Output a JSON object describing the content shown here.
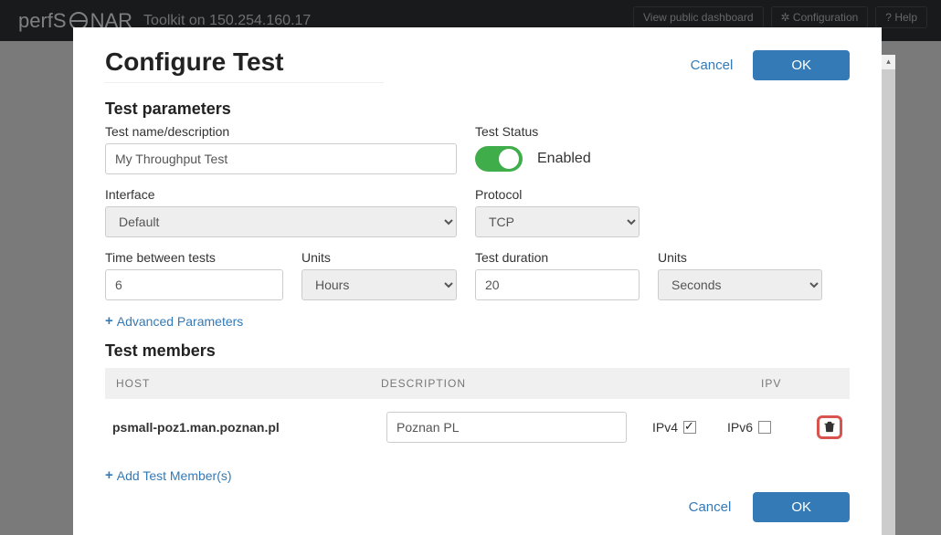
{
  "header": {
    "brand_left": "perfS",
    "brand_right": "NAR",
    "toolkit": "Toolkit on 150.254.160.17",
    "view_dashboard": "View public dashboard",
    "configuration": "Configuration",
    "help": "Help"
  },
  "modal": {
    "title": "Configure Test",
    "cancel": "Cancel",
    "ok": "OK",
    "params_heading": "Test parameters",
    "name_label": "Test name/description",
    "name_value": "My Throughput Test",
    "status_label": "Test Status",
    "status_value": "Enabled",
    "interface_label": "Interface",
    "interface_value": "Default",
    "protocol_label": "Protocol",
    "protocol_value": "TCP",
    "time_between_label": "Time between tests",
    "time_between_value": "6",
    "units1_label": "Units",
    "units1_value": "Hours",
    "duration_label": "Test duration",
    "duration_value": "20",
    "units2_label": "Units",
    "units2_value": "Seconds",
    "advanced": "Advanced Parameters",
    "members_heading": "Test members",
    "th_host": "HOST",
    "th_desc": "DESCRIPTION",
    "th_ipv": "IPV",
    "members": [
      {
        "host": "psmall-poz1.man.poznan.pl",
        "description": "Poznan PL",
        "ipv4_label": "IPv4",
        "ipv4_checked": true,
        "ipv6_label": "IPv6",
        "ipv6_checked": false
      }
    ],
    "add_members": "Add Test Member(s)"
  }
}
